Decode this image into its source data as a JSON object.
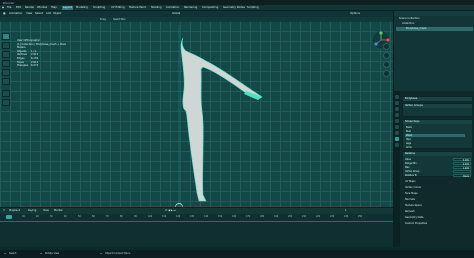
{
  "window": {
    "title": "Blender"
  },
  "menu": {
    "items": [
      "File",
      "Edit",
      "Render",
      "Window",
      "Help"
    ],
    "tabs": [
      "Layout",
      "Modeling",
      "Sculpting",
      "UV Editing",
      "Texture Paint",
      "Shading",
      "Animation",
      "Rendering",
      "Compositing",
      "Geometry Nodes",
      "Scripting"
    ],
    "active_tab": "Layout",
    "scene": "Scene",
    "view_layer": "View Layer"
  },
  "viewport": {
    "header": {
      "mode": "Animation",
      "editor": "Global",
      "view": "View",
      "select": "Select",
      "add": "Add",
      "object": "Object",
      "options": "Options"
    },
    "header2": {
      "tool": "Drag",
      "selection": "Select Box"
    },
    "stats": {
      "title": "User Orthographic",
      "subtitle": "(1) Collection | Bodybase_mesh + Bust",
      "units": "Meters",
      "rows": [
        {
          "k": "Objects",
          "v": "1 / 1"
        },
        {
          "k": "Vertices",
          "v": "2,911"
        },
        {
          "k": "Edges",
          "v": "6,159"
        },
        {
          "k": "Faces",
          "v": "2,911"
        },
        {
          "k": "Triangles",
          "v": "6,574"
        }
      ]
    }
  },
  "timeline": {
    "header": {
      "playback": "Playback",
      "keying": "Keying",
      "view": "View",
      "marker": "Marker"
    },
    "ticks": [
      "0",
      "10",
      "20",
      "30",
      "40",
      "50",
      "60",
      "70",
      "80",
      "90",
      "100",
      "110",
      "120",
      "130",
      "140",
      "150",
      "160",
      "170",
      "180",
      "190",
      "200",
      "210",
      "220",
      "230",
      "240",
      "250"
    ],
    "current_frame": "1"
  },
  "statusbar": {
    "select": "Select",
    "rotate": "Rotate View",
    "context": "Object Context Menu"
  },
  "outliner": {
    "rows": [
      "Scene Collection",
      "Collection",
      "Bodybase_mesh"
    ],
    "selected": "Bodybase_mesh"
  },
  "properties": {
    "object_name": "Bodybase",
    "vertex_groups_label": "Vertex Groups",
    "shape_keys_label": "Shape Keys",
    "shape_keys": [
      "Basis",
      "Bust",
      "Waist",
      "Hips",
      "Legs",
      "Arms"
    ],
    "selected_shape_key": "Waist",
    "relative_label": "Relative",
    "fields": [
      {
        "k": "Value",
        "v": "0.000"
      },
      {
        "k": "Range Min",
        "v": "0.000"
      },
      {
        "k": "Max",
        "v": "1.000"
      },
      {
        "k": "Vertex Group",
        "v": ""
      },
      {
        "k": "Relative To",
        "v": "Basis"
      }
    ],
    "collapsed": [
      "UV Maps",
      "Vertex Colors",
      "Face Maps",
      "Normals",
      "Texture Space",
      "Remesh",
      "Geometry Data",
      "Custom Properties"
    ]
  },
  "colors": {
    "accent": "#2fa29e",
    "figure_outline": "#55e0c8",
    "arm_highlight": "#4fe0c0"
  }
}
